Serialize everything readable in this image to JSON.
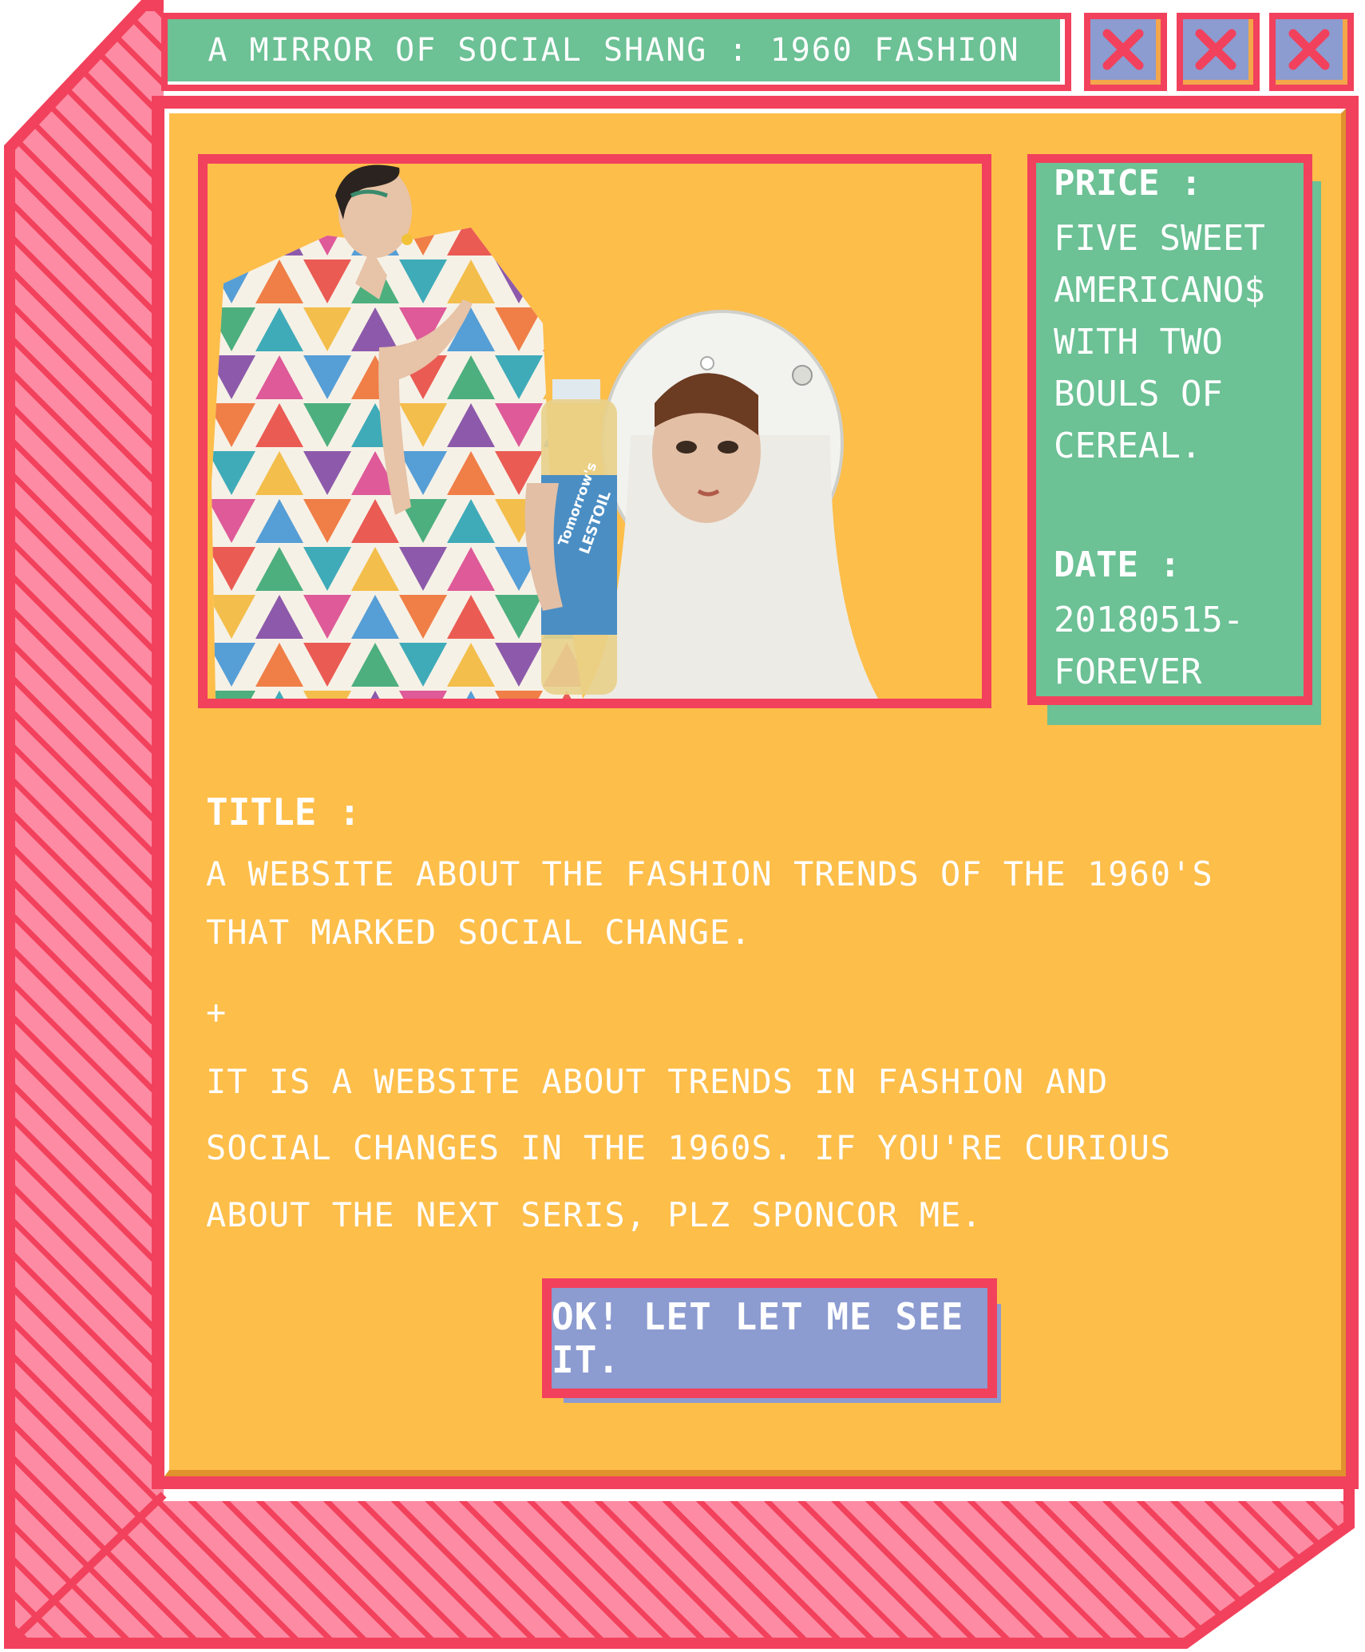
{
  "window": {
    "title": "A MIRROR OF SOCIAL SHANG : 1960 FASHION",
    "controls": [
      {
        "icon": "close-icon"
      },
      {
        "icon": "close-icon"
      },
      {
        "icon": "close-icon"
      }
    ]
  },
  "image": {
    "bottle_label_line1": "Tomorrow's",
    "bottle_label_line2": "LESTOIL"
  },
  "info": {
    "price_label": "PRICE :",
    "price_lines": [
      "FIVE SWEET",
      "AMERICANO$",
      "WITH TWO",
      "BOULS OF",
      "CEREAL."
    ],
    "date_label": "DATE :",
    "date_lines": [
      "20180515-",
      "FOREVER"
    ]
  },
  "description": {
    "title_label": "TITLE :",
    "title_lines": [
      "A WEBSITE ABOUT THE FASHION TRENDS OF THE 1960'S",
      "THAT MARKED SOCIAL CHANGE."
    ],
    "separator": "+",
    "body_lines": [
      "IT IS A WEBSITE ABOUT TRENDS IN FASHION AND",
      "SOCIAL CHANGES IN THE 1960S. IF YOU'RE CURIOUS",
      "ABOUT THE NEXT SERIS, PLZ SPONCOR ME."
    ]
  },
  "cta": {
    "label": "OK! LET LET ME SEE IT."
  },
  "colors": {
    "frame_red": "#f2415c",
    "stripe_pink": "#fc8ba3",
    "panel_yellow": "#fdbe4a",
    "title_green": "#6cc195",
    "button_lavender": "#8c9bd0"
  }
}
